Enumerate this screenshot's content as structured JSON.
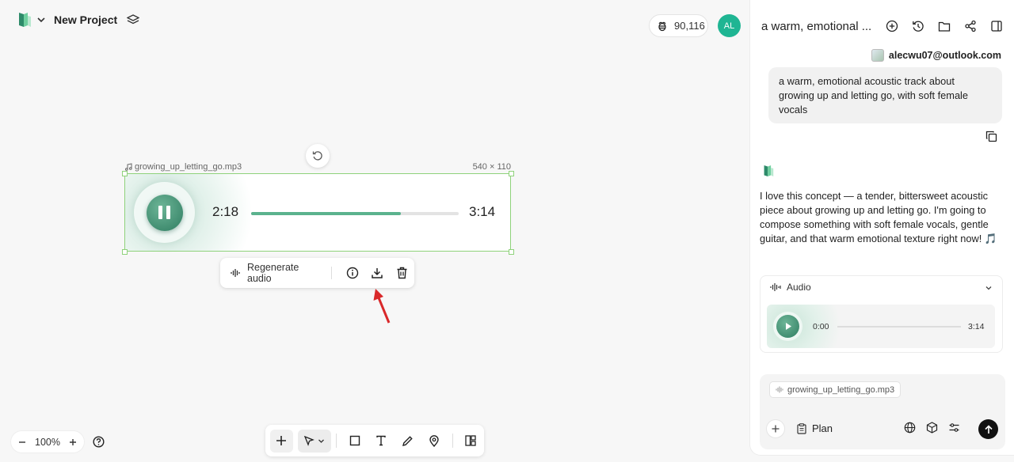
{
  "header": {
    "project_title": "New Project",
    "credits": "90,116",
    "avatar_initials": "AL"
  },
  "canvas": {
    "filename": "growing_up_letting_go.mp3",
    "dimensions": "540 × 110",
    "player": {
      "current_time": "2:18",
      "total_time": "3:14",
      "progress": 0.72
    },
    "toolbar": {
      "regenerate_label": "Regenerate audio"
    },
    "zoom_level": "100%"
  },
  "panel": {
    "title": "a warm, emotional ...",
    "user_email": "alecwu07@outlook.com",
    "user_message": "a warm, emotional acoustic track about growing up and letting go, with soft female vocals",
    "assistant_message": "I love this concept — a tender, bittersweet acoustic piece about growing up and letting go. I'm going to compose something with soft female vocals, gentle guitar, and that warm emotional texture right now! 🎵",
    "audio_card": {
      "label": "Audio",
      "current_time": "0:00",
      "total_time": "3:14"
    },
    "composer": {
      "attachment": "growing_up_letting_go.mp3",
      "mode_label": "Plan"
    }
  },
  "colors": {
    "accent_green": "#1fb593",
    "player_green": "#5bb28e",
    "selection_border": "#8fd27b",
    "annotation_arrow": "#d9282a"
  }
}
